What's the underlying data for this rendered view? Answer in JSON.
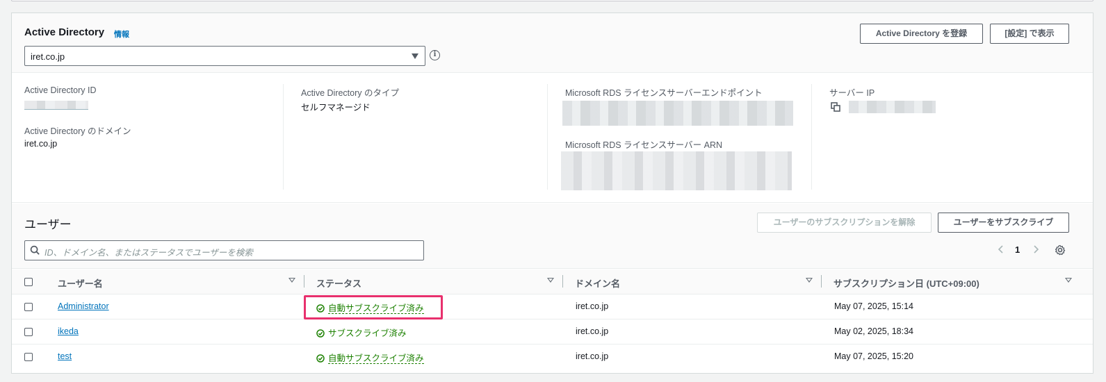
{
  "active_directory": {
    "title": "Active Directory",
    "info_link": "情報",
    "selected": "iret.co.jp",
    "register_button": "Active Directory を登録",
    "settings_button": "[設定] で表示"
  },
  "details": {
    "ad_id_label": "Active Directory ID",
    "ad_domain_label": "Active Directory のドメイン",
    "ad_domain_value": "iret.co.jp",
    "ad_type_label": "Active Directory のタイプ",
    "ad_type_value": "セルフマネージド",
    "rds_endpoint_label": "Microsoft RDS ライセンスサーバーエンドポイント",
    "rds_arn_label": "Microsoft RDS ライセンスサーバー ARN",
    "server_ip_label": "サーバー IP"
  },
  "users": {
    "title": "ユーザー",
    "unsubscribe_button": "ユーザーのサブスクリプションを解除",
    "subscribe_button": "ユーザーをサブスクライブ",
    "search_placeholder": "ID、ドメイン名、またはステータスでユーザーを検索",
    "page": "1",
    "columns": [
      "ユーザー名",
      "ステータス",
      "ドメイン名",
      "サブスクリプション日 (UTC+09:00)"
    ],
    "rows": [
      {
        "name": "Administrator",
        "status": "自動サブスクライブ済み",
        "domain": "iret.co.jp",
        "date": "May 07, 2025, 15:14"
      },
      {
        "name": "ikeda",
        "status": "サブスクライブ済み",
        "domain": "iret.co.jp",
        "date": "May 02, 2025, 18:34"
      },
      {
        "name": "test",
        "status": "自動サブスクライブ済み",
        "domain": "iret.co.jp",
        "date": "May 07, 2025, 15:20"
      }
    ]
  },
  "colors": {
    "link": "#0073bb",
    "success": "#1d8102",
    "highlight": "#e8306d"
  }
}
